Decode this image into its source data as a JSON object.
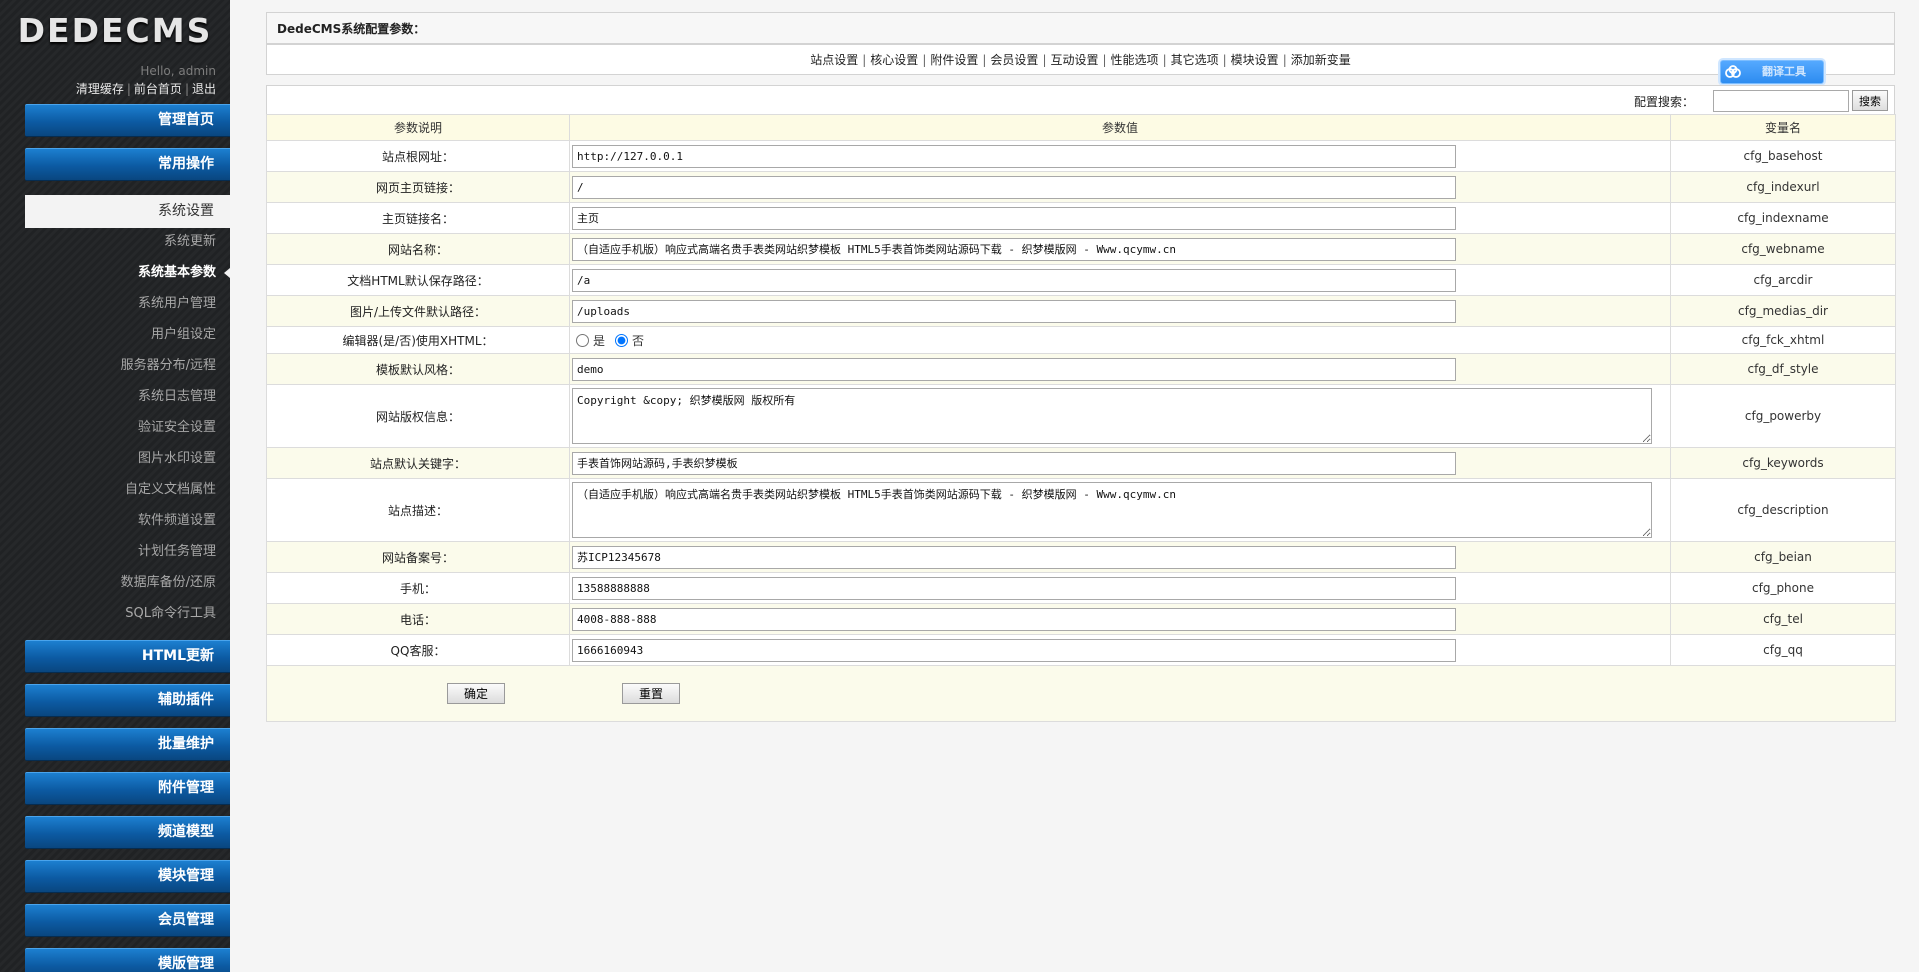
{
  "sidebar": {
    "logo": "DEDECMS",
    "hello": "Hello, admin",
    "links": [
      "清理缓存",
      "前台首页",
      "退出"
    ],
    "top_buttons": [
      "管理首页",
      "常用操作"
    ],
    "active_section": "系统设置",
    "sub_items": [
      "系统更新",
      "系统基本参数",
      "系统用户管理",
      "用户组设定",
      "服务器分布/远程",
      "系统日志管理",
      "验证安全设置",
      "图片水印设置",
      "自定义文档属性",
      "软件频道设置",
      "计划任务管理",
      "数据库备份/还原",
      "SQL命令行工具"
    ],
    "bottom_buttons": [
      "HTML更新",
      "辅助插件",
      "批量维护",
      "附件管理",
      "频道模型",
      "模块管理",
      "会员管理",
      "模版管理"
    ]
  },
  "main": {
    "title": "DedeCMS系统配置参数：",
    "tabs": [
      "站点设置",
      "核心设置",
      "附件设置",
      "会员设置",
      "互动设置",
      "性能选项",
      "其它选项",
      "模块设置",
      "添加新变量"
    ],
    "badge_label": "翻译工具",
    "search_label": "配置搜索：",
    "search_value": "",
    "search_button": "搜索",
    "headers": [
      "参数说明",
      "参数值",
      "变量名"
    ],
    "rows": [
      {
        "label": "站点根网址：",
        "value": "http://127.0.0.1",
        "var": "cfg_basehost"
      },
      {
        "label": "网页主页链接：",
        "value": "/",
        "var": "cfg_indexurl"
      },
      {
        "label": "主页链接名：",
        "value": "主页",
        "var": "cfg_indexname"
      },
      {
        "label": "网站名称：",
        "value": "（自适应手机版）响应式高端名贵手表类网站织梦模板 HTML5手表首饰类网站源码下载 - 织梦模版网 - Www.qcymw.cn",
        "var": "cfg_webname"
      },
      {
        "label": "文档HTML默认保存路径：",
        "value": "/a",
        "var": "cfg_arcdir"
      },
      {
        "label": "图片/上传文件默认路径：",
        "value": "/uploads",
        "var": "cfg_medias_dir"
      },
      {
        "label": "编辑器(是/否)使用XHTML：",
        "options": [
          "是",
          "否"
        ],
        "selected": "否",
        "var": "cfg_fck_xhtml"
      },
      {
        "label": "模板默认风格：",
        "value": "demo",
        "var": "cfg_df_style"
      },
      {
        "label": "网站版权信息：",
        "value": "Copyright &copy; 织梦模版网 版权所有",
        "var": "cfg_powerby"
      },
      {
        "label": "站点默认关键字：",
        "value": "手表首饰网站源码,手表织梦模板",
        "var": "cfg_keywords"
      },
      {
        "label": "站点描述：",
        "value": "（自适应手机版）响应式高端名贵手表类网站织梦模板 HTML5手表首饰类网站源码下载 - 织梦模版网 - Www.qcymw.cn",
        "var": "cfg_description"
      },
      {
        "label": "网站备案号：",
        "value": "苏ICP12345678",
        "var": "cfg_beian"
      },
      {
        "label": "手机：",
        "value": "13588888888",
        "var": "cfg_phone"
      },
      {
        "label": "电话：",
        "value": "4008-888-888",
        "var": "cfg_tel"
      },
      {
        "label": "QQ客服：",
        "value": "1666160943",
        "var": "cfg_qq"
      }
    ],
    "submit_button": "确定",
    "reset_button": "重置"
  }
}
